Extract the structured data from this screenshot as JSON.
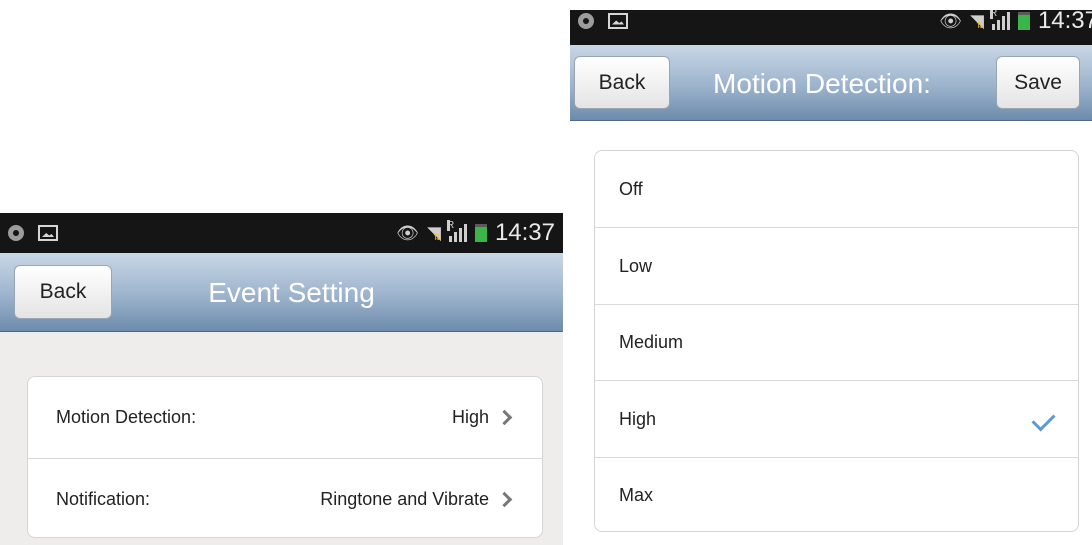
{
  "left_screen": {
    "status_time": "14:37",
    "nav": {
      "back_label": "Back",
      "title": "Event Setting"
    },
    "settings": [
      {
        "label": "Motion Detection:",
        "value": "High"
      },
      {
        "label": "Notification:",
        "value": "Ringtone and Vibrate"
      }
    ],
    "colors": {
      "background": "#efedeb",
      "navbar": "#9cb3cc"
    }
  },
  "right_screen": {
    "status_time": "14:37",
    "nav": {
      "back_label": "Back",
      "title": "Motion Detection:",
      "save_label": "Save"
    },
    "options": [
      "Off",
      "Low",
      "Medium",
      "High",
      "Max"
    ],
    "selected": "High",
    "colors": {
      "check": "#5b9bd5"
    }
  }
}
